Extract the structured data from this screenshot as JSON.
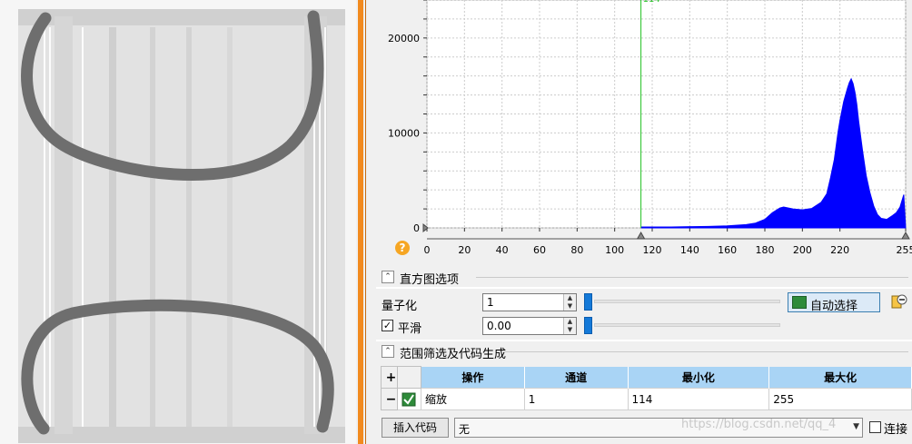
{
  "histogram": {
    "y_ticks": [
      "20000",
      "10000",
      "0"
    ],
    "x_ticks": [
      "0",
      "20",
      "40",
      "60",
      "80",
      "100",
      "120",
      "140",
      "160",
      "180",
      "200",
      "220",
      "255"
    ],
    "threshold_value": "114",
    "max_marker": "255",
    "threshold_color": "#22c122",
    "bar_color": "#0000ff"
  },
  "chart_data": {
    "type": "area",
    "x": [
      114,
      120,
      130,
      140,
      150,
      160,
      170,
      175,
      180,
      184,
      188,
      190,
      195,
      200,
      205,
      210,
      213,
      215,
      217,
      219,
      220,
      222,
      224,
      225,
      226,
      227,
      228,
      229,
      230,
      232,
      234,
      236,
      238,
      240,
      242,
      245,
      248,
      250,
      252,
      254,
      255
    ],
    "y": [
      0,
      80,
      100,
      130,
      160,
      220,
      350,
      500,
      900,
      1600,
      2100,
      2200,
      2000,
      1900,
      2050,
      2700,
      3600,
      5300,
      7200,
      10100,
      11300,
      13300,
      14700,
      15300,
      15700,
      15200,
      14300,
      13000,
      11200,
      8200,
      5500,
      3700,
      2300,
      1400,
      1000,
      900,
      1300,
      1600,
      2200,
      3500,
      0
    ],
    "xlim": [
      0,
      255
    ],
    "ylim": [
      0,
      24000
    ],
    "y_ticks": [
      0,
      10000,
      20000
    ],
    "x_ticks": [
      0,
      20,
      40,
      60,
      80,
      100,
      120,
      140,
      160,
      180,
      200,
      220,
      255
    ],
    "threshold": 114,
    "grid": true
  },
  "hist_options": {
    "title": "直方图选项",
    "quantize_label": "量子化",
    "quantize_value": "1",
    "smooth_label": "平滑",
    "smooth_checked": "✓",
    "smooth_value": "0.00",
    "auto_select_label": "自动选择"
  },
  "filter_section": {
    "title": "范围筛选及代码生成",
    "columns": [
      "操作",
      "通道",
      "最小化",
      "最大化"
    ],
    "add_symbol": "+",
    "remove_symbol": "−",
    "rows": [
      {
        "operation": "缩放",
        "channel": "1",
        "min": "114",
        "max": "255"
      }
    ]
  },
  "bottom_bar": {
    "insert_code_label": "插入代码",
    "combo_value": "无",
    "watermark": "https://blog.csdn.net/qq_4",
    "link_label": "连接"
  }
}
